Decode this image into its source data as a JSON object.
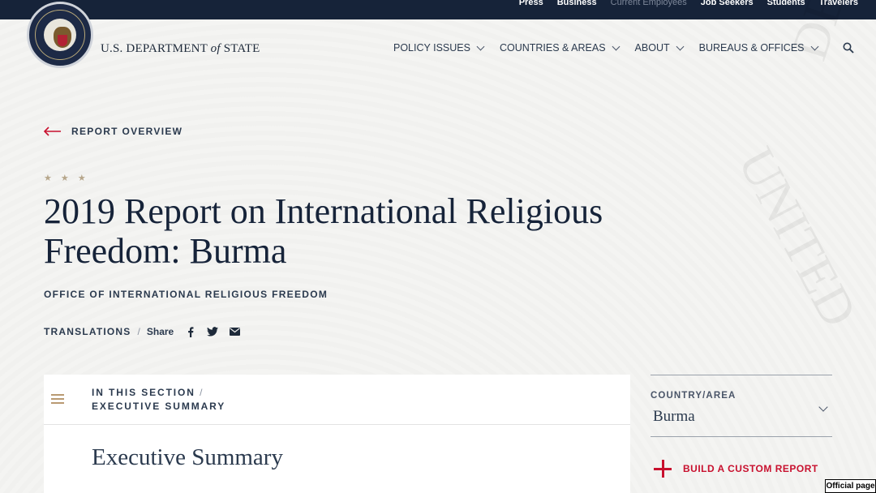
{
  "topbar": {
    "links": [
      {
        "label": "Press",
        "muted": false
      },
      {
        "label": "Business",
        "muted": false
      },
      {
        "label": "Current Employees",
        "muted": true
      },
      {
        "label": "Job Seekers",
        "muted": false
      },
      {
        "label": "Students",
        "muted": false
      },
      {
        "label": "Travelers",
        "muted": false
      }
    ]
  },
  "header": {
    "dept_prefix": "U.S. DEPARTMENT",
    "dept_of": "of",
    "dept_suffix": "STATE",
    "nav": [
      {
        "label": "POLICY ISSUES"
      },
      {
        "label": "COUNTRIES & AREAS"
      },
      {
        "label": "ABOUT"
      },
      {
        "label": "BUREAUS & OFFICES"
      }
    ],
    "search_icon": "search-icon"
  },
  "page": {
    "back_link": "REPORT OVERVIEW",
    "stars": "★ ★ ★",
    "title": "2019 Report on International Religious Freedom: Burma",
    "office": "OFFICE OF INTERNATIONAL RELIGIOUS FREEDOM",
    "translations": "TRANSLATIONS",
    "share_label": "Share"
  },
  "section": {
    "in_this_section": "IN THIS SECTION",
    "current": "EXECUTIVE SUMMARY",
    "heading": "Executive Summary"
  },
  "sidebar": {
    "country_label": "COUNTRY/AREA",
    "country_value": "Burma",
    "custom_report": "BUILD A CUSTOM REPORT"
  },
  "badge": "Official page",
  "colors": {
    "navy": "#162339",
    "accent_red": "#c8102e",
    "gold": "#b99a72"
  }
}
